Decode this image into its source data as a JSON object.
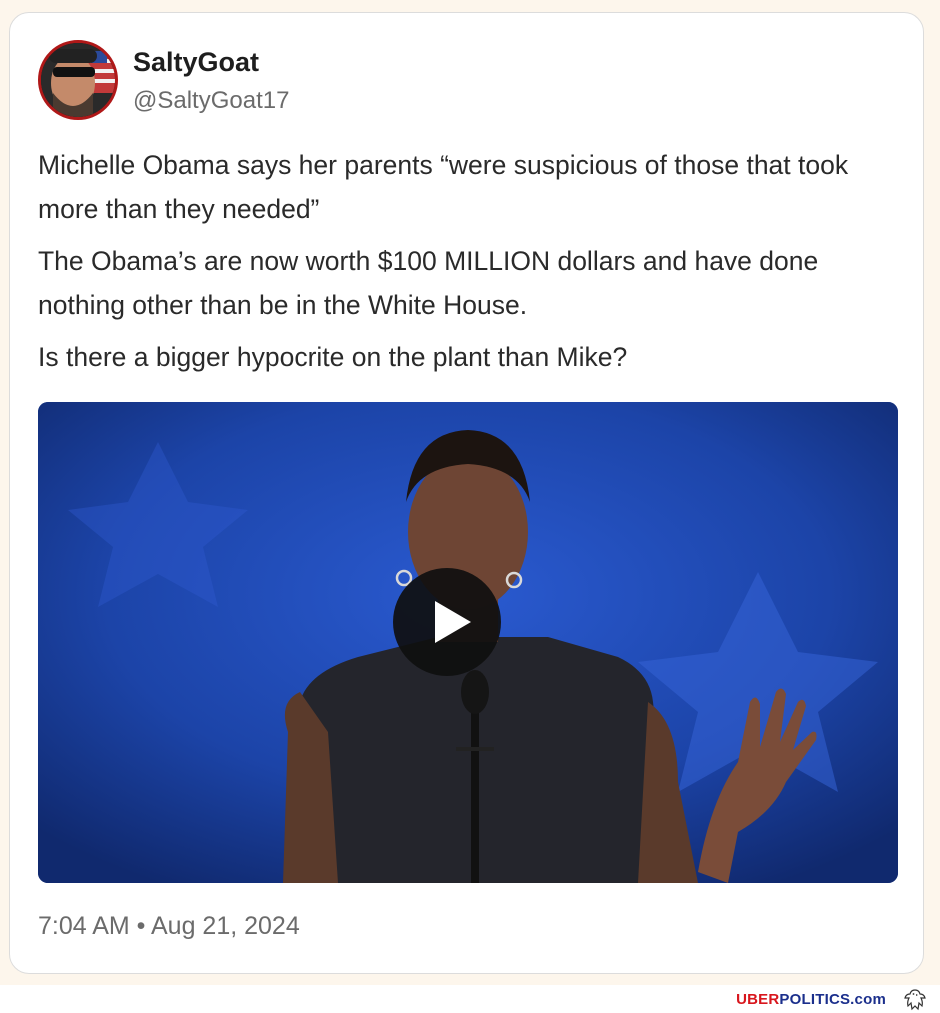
{
  "post": {
    "display_name": "SaltyGoat",
    "handle": "@SaltyGoat17",
    "paragraphs": [
      "Michelle Obama says her parents “were suspicious of those that took more than they needed”",
      "The Obama’s are now worth $100 MILLION dollars and have done nothing other than be in the White House.",
      "Is there a bigger hypocrite on the plant than Mike?"
    ],
    "timestamp": "7:04 AM • Aug 21, 2024"
  },
  "media": {
    "type": "video",
    "play_icon": "play-icon"
  },
  "footer": {
    "brand_red": "UBER",
    "brand_blue": "POLITICS.com",
    "logo_icon": "eagle-icon"
  },
  "colors": {
    "avatar_border": "#b01818",
    "brand_red": "#d8161d",
    "brand_blue": "#1b2f8c",
    "stage_blue": "#1a3f9a"
  }
}
